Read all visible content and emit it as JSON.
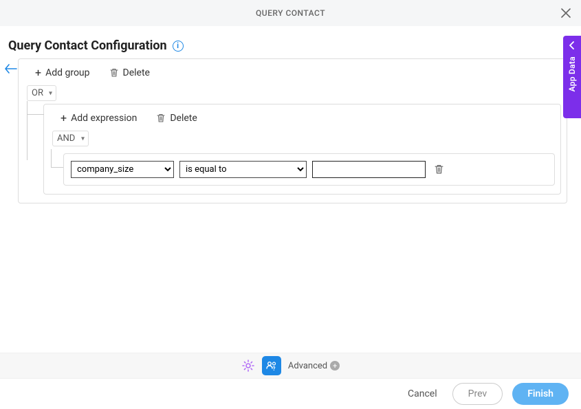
{
  "header": {
    "title": "QUERY CONTACT"
  },
  "page": {
    "title": "Query Contact Configuration"
  },
  "sidebar": {
    "tab_label": "App Data"
  },
  "builder": {
    "group_outer": {
      "add_label": "Add group",
      "delete_label": "Delete",
      "logic": "OR"
    },
    "group_inner": {
      "add_label": "Add expression",
      "delete_label": "Delete",
      "logic": "AND"
    },
    "expression": {
      "field": "company_size",
      "operator": "is equal to",
      "value": ""
    }
  },
  "toolbar": {
    "advanced_label": "Advanced"
  },
  "footer": {
    "cancel": "Cancel",
    "prev": "Prev",
    "finish": "Finish"
  }
}
